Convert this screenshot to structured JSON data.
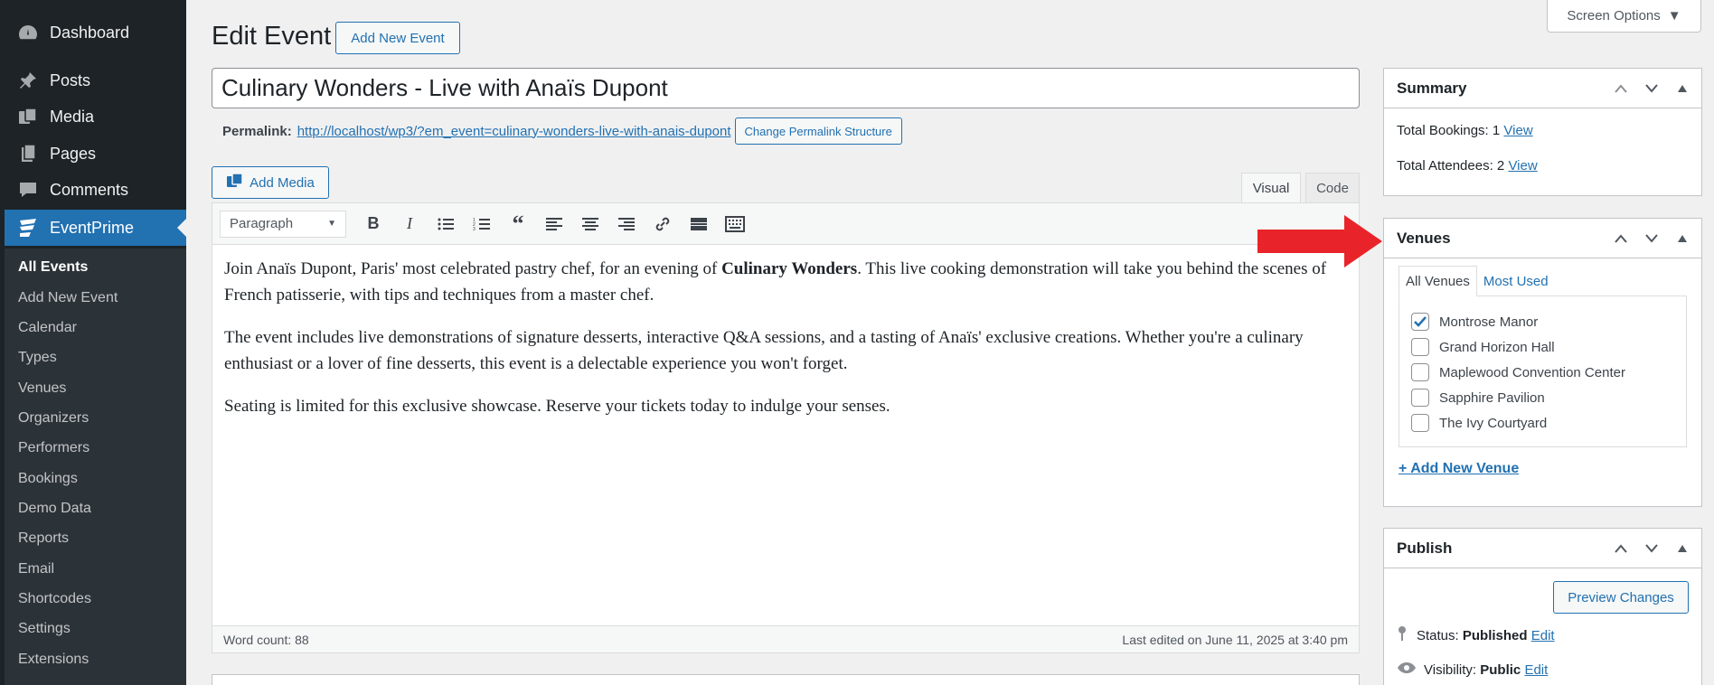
{
  "sidebar": {
    "top_items": [
      {
        "label": "Dashboard",
        "icon": "dashboard-icon"
      },
      {
        "label": "Posts",
        "icon": "pin-icon"
      },
      {
        "label": "Media",
        "icon": "media-icon"
      },
      {
        "label": "Pages",
        "icon": "pages-icon"
      },
      {
        "label": "Comments",
        "icon": "comment-icon"
      },
      {
        "label": "EventPrime",
        "icon": "eventprime-icon"
      }
    ],
    "submenu": [
      "All Events",
      "Add New Event",
      "Calendar",
      "Types",
      "Venues",
      "Organizers",
      "Performers",
      "Bookings",
      "Demo Data",
      "Reports",
      "Email",
      "Shortcodes",
      "Settings",
      "Extensions"
    ]
  },
  "header": {
    "title": "Edit Event",
    "add_new": "Add New Event",
    "screen_options": "Screen Options"
  },
  "post": {
    "title": "Culinary Wonders - Live with Anaïs Dupont",
    "permalink_label": "Permalink:",
    "permalink_url": "http://localhost/wp3/?em_event=culinary-wonders-live-with-anais-dupont",
    "change_permalink": "Change Permalink Structure"
  },
  "editor": {
    "add_media": "Add Media",
    "tab_visual": "Visual",
    "tab_code": "Code",
    "format": "Paragraph",
    "p1_before": "Join Anaïs Dupont, Paris' most celebrated pastry chef, for an evening of ",
    "p1_bold": "Culinary Wonders",
    "p1_after": ". This live cooking demonstration will take you behind the scenes of French patisserie, with tips and techniques from a master chef.",
    "p2": "The event includes live demonstrations of signature desserts, interactive Q&A sessions, and a tasting of Anaïs' exclusive creations. Whether you're a culinary enthusiast or a lover of fine desserts, this event is a delectable experience you won't forget.",
    "p3": "Seating is limited for this exclusive showcase. Reserve your tickets today to indulge your senses.",
    "word_count": "Word count: 88",
    "last_edited": "Last edited on June 11, 2025 at 3:40 pm"
  },
  "summary": {
    "title": "Summary",
    "bookings_label": "Total Bookings: 1",
    "attendees_label": "Total Attendees: 2",
    "view": "View"
  },
  "venues": {
    "title": "Venues",
    "tab_all": "All Venues",
    "tab_most_used": "Most Used",
    "items": [
      {
        "label": "Montrose Manor",
        "checked": true
      },
      {
        "label": "Grand Horizon Hall",
        "checked": false
      },
      {
        "label": "Maplewood Convention Center",
        "checked": false
      },
      {
        "label": "Sapphire Pavilion",
        "checked": false
      },
      {
        "label": "The Ivy Courtyard",
        "checked": false
      }
    ],
    "add_new": "+ Add New Venue"
  },
  "publish": {
    "title": "Publish",
    "preview": "Preview Changes",
    "status_label": "Status:",
    "status_value": "Published",
    "visibility_label": "Visibility:",
    "visibility_value": "Public",
    "edit": "Edit"
  },
  "colors": {
    "accent": "#2271b1",
    "sidebar": "#1d2327",
    "annotation_arrow": "#e8242a"
  }
}
